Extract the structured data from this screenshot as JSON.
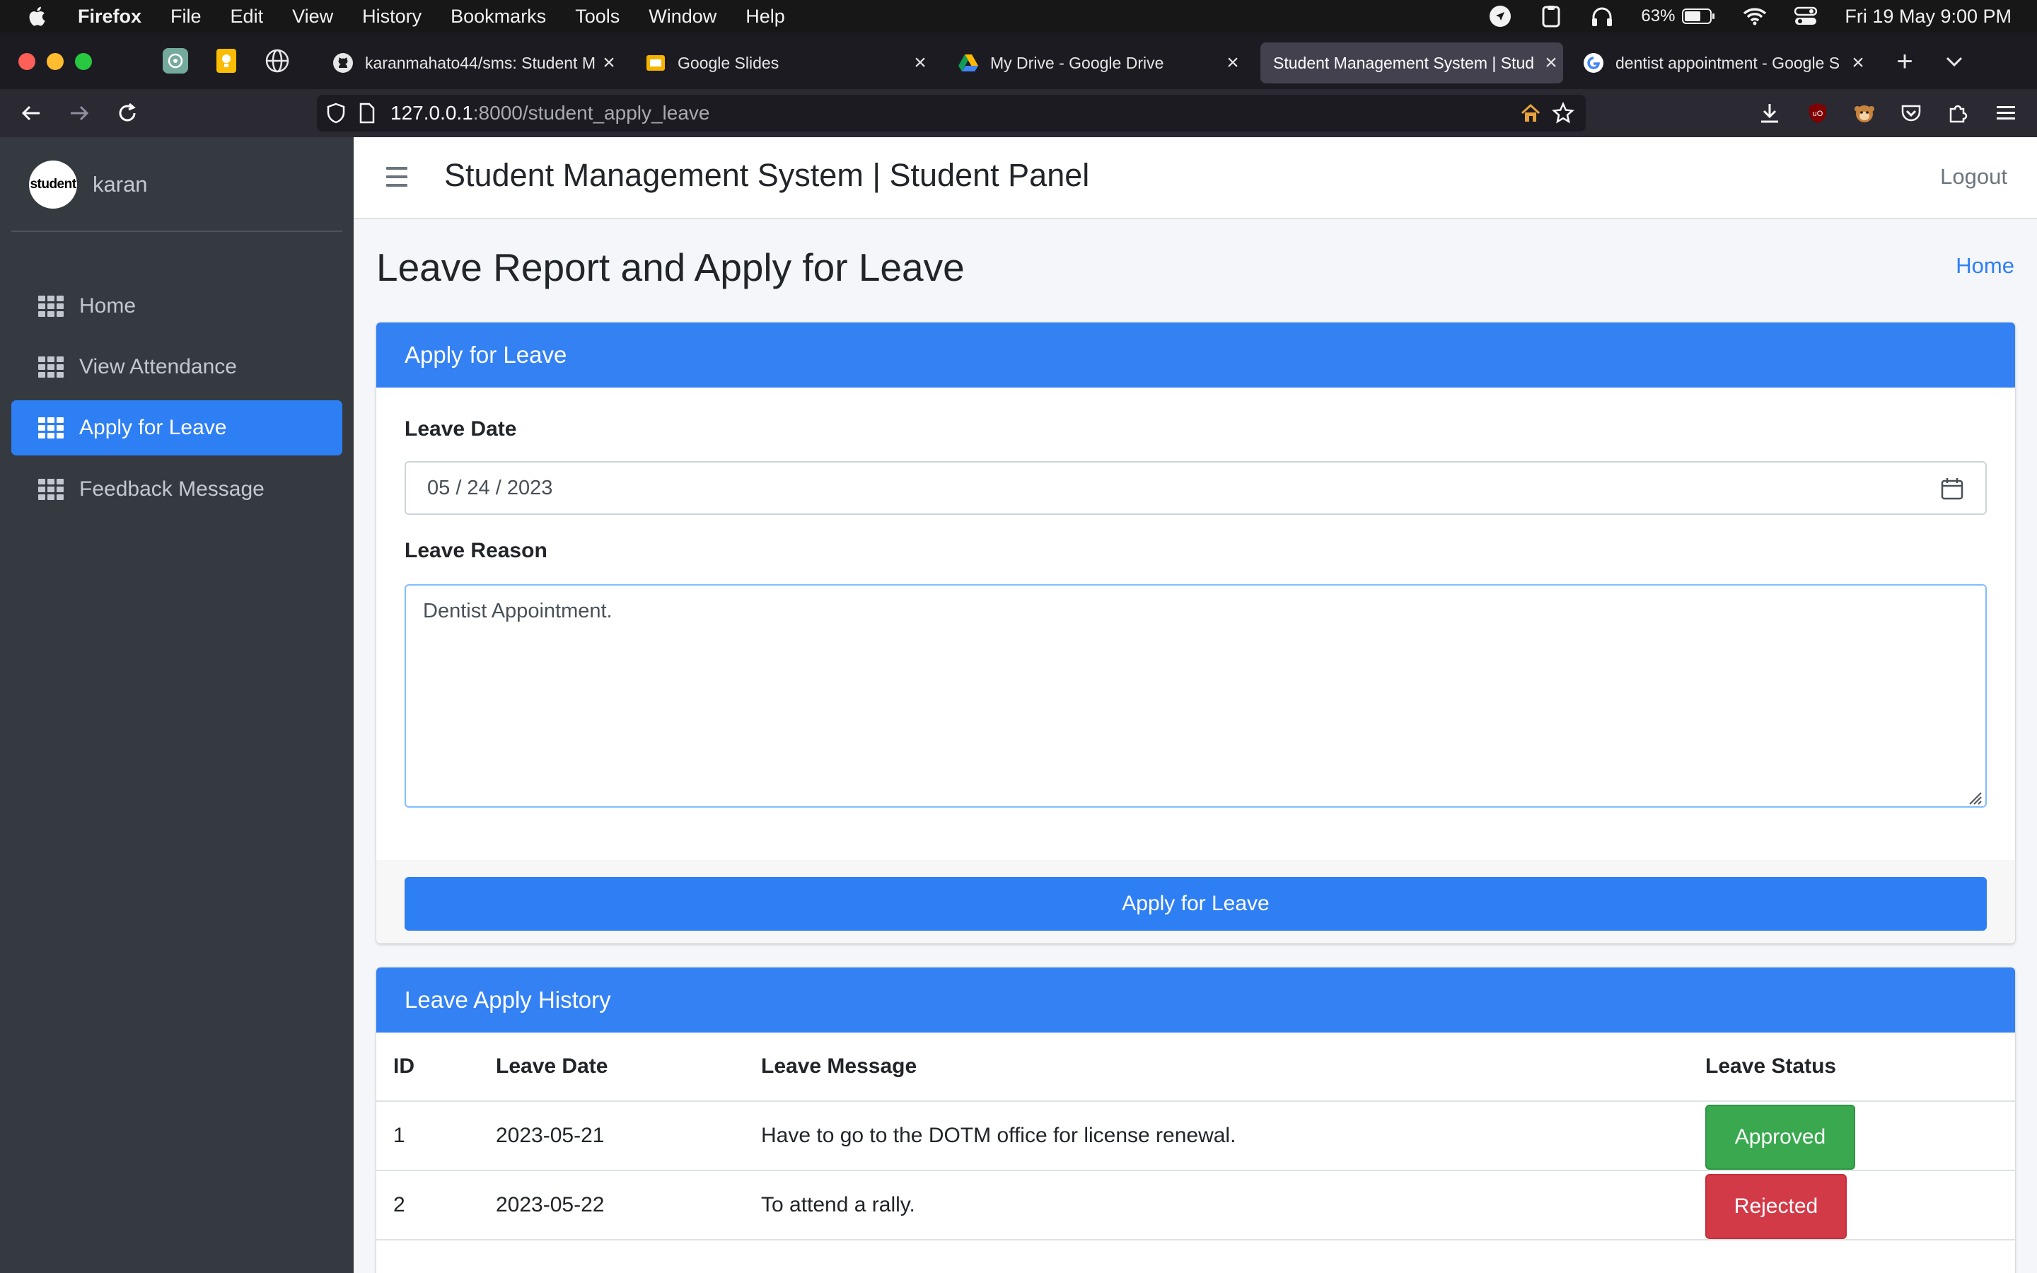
{
  "menubar": {
    "app": "Firefox",
    "items": [
      "File",
      "Edit",
      "View",
      "History",
      "Bookmarks",
      "Tools",
      "Window",
      "Help"
    ],
    "battery": "63%",
    "datetime": "Fri 19 May  9:00 PM"
  },
  "tabs": [
    {
      "title": "karanmahato44/sms: Student M",
      "icon": "github-icon"
    },
    {
      "title": "Google Slides",
      "icon": "slides-icon"
    },
    {
      "title": "My Drive - Google Drive",
      "icon": "drive-icon"
    },
    {
      "title": "Student Management System | Stud",
      "icon": "none",
      "active": true
    },
    {
      "title": "dentist appointment - Google S",
      "icon": "google-icon"
    }
  ],
  "urlbar": {
    "host": "127.0.0.1",
    "path": ":8000/student_apply_leave"
  },
  "sidebar": {
    "avatar_text": "student",
    "username": "karan",
    "items": [
      {
        "label": "Home"
      },
      {
        "label": "View Attendance"
      },
      {
        "label": "Apply for Leave",
        "active": true
      },
      {
        "label": "Feedback Message"
      }
    ]
  },
  "header": {
    "title": "Student Management System | Student Panel",
    "logout": "Logout"
  },
  "main": {
    "page_title": "Leave Report and Apply for Leave",
    "breadcrumb_home": "Home",
    "apply_card": {
      "title": "Apply for Leave",
      "date_label": "Leave Date",
      "date_value": "05 / 24 / 2023",
      "reason_label": "Leave Reason",
      "reason_value": "Dentist Appointment.",
      "submit_label": "Apply for Leave"
    },
    "history_card": {
      "title": "Leave Apply History",
      "columns": [
        "ID",
        "Leave Date",
        "Leave Message",
        "Leave Status"
      ],
      "rows": [
        {
          "id": "1",
          "date": "2023-05-21",
          "message": "Have to go to the DOTM office for license renewal.",
          "status": "Approved"
        },
        {
          "id": "2",
          "date": "2023-05-22",
          "message": "To attend a rally.",
          "status": "Rejected"
        }
      ]
    }
  },
  "colors": {
    "primary": "#2f7ff4",
    "sidebar_bg": "#343a40",
    "approved": "#3aa84f",
    "rejected": "#d33a47"
  }
}
